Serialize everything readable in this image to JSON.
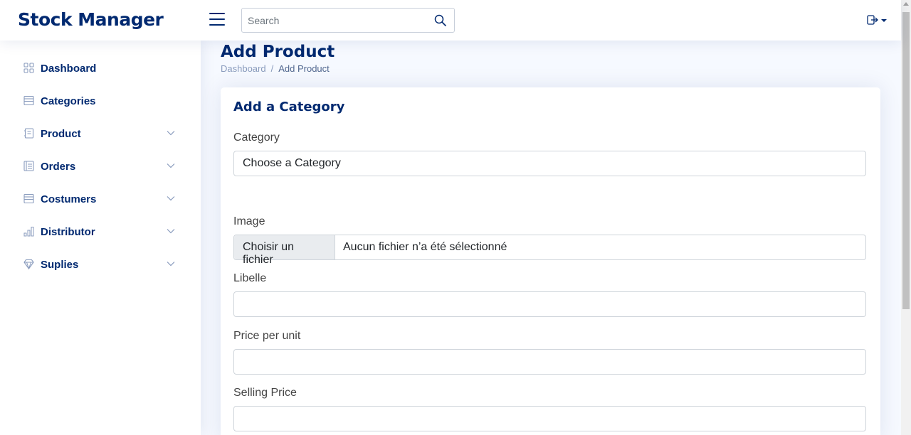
{
  "header": {
    "logo": "Stock Manager",
    "search_placeholder": "Search",
    "icons": {
      "menu": "hamburger-icon",
      "search": "search-icon",
      "profile": "logout-icon"
    }
  },
  "sidebar": {
    "items": [
      {
        "label": "Dashboard",
        "icon": "grid-icon",
        "has_submenu": false
      },
      {
        "label": "Categories",
        "icon": "layout-icon",
        "has_submenu": false
      },
      {
        "label": "Product",
        "icon": "journal-icon",
        "has_submenu": true
      },
      {
        "label": "Orders",
        "icon": "layout-text-icon",
        "has_submenu": true
      },
      {
        "label": "Costumers",
        "icon": "layout-icon",
        "has_submenu": true
      },
      {
        "label": "Distributor",
        "icon": "bar-chart-icon",
        "has_submenu": true
      },
      {
        "label": "Suplies",
        "icon": "gem-icon",
        "has_submenu": true
      }
    ]
  },
  "main": {
    "page_title": "Add Product",
    "breadcrumb": [
      "Dashboard",
      "Add Product"
    ],
    "breadcrumb_sep": "/"
  },
  "form": {
    "title": "Add a Category",
    "category_label": "Category",
    "category_value": "Choose a Category",
    "image_label": "Image",
    "file_button": "Choisir un fichier",
    "file_status": "Aucun fichier n’a été sélectionné",
    "libelle_label": "Libelle",
    "libelle_value": "",
    "price_label": "Price per unit",
    "price_value": "",
    "selling_label": "Selling Price",
    "selling_value": ""
  },
  "colors": {
    "primary": "#012970",
    "background": "#f6f9ff",
    "muted": "#899bbd"
  }
}
